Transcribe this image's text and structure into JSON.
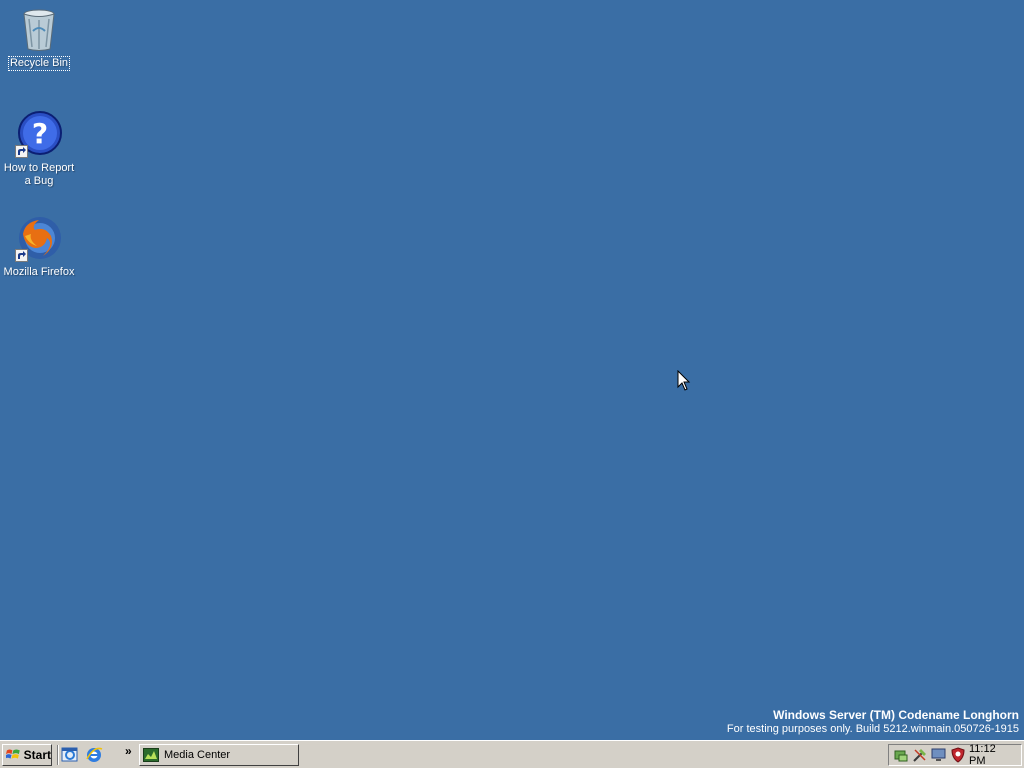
{
  "desktop": {
    "background_color": "#3a6ea5",
    "icons": [
      {
        "label": "Recycle Bin",
        "icon": "recycle-bin-icon"
      },
      {
        "label": "How to Report a Bug",
        "icon": "help-icon"
      },
      {
        "label": "Mozilla Firefox",
        "icon": "firefox-icon"
      }
    ]
  },
  "watermark": {
    "title": "Windows Server (TM) Codename Longhorn",
    "subtitle": "For testing purposes only. Build 5212.winmain.050726-1915"
  },
  "taskbar": {
    "start_label": "Start",
    "quicklaunch_icons": [
      "show-desktop-icon",
      "internet-explorer-icon"
    ],
    "overflow_label": "»",
    "tasks": [
      {
        "label": "Media Center",
        "icon": "media-center-icon"
      }
    ],
    "tray_icons": [
      "network-icon",
      "tools-icon",
      "monitor-icon",
      "security-shield-icon"
    ],
    "clock": "11:12 PM"
  }
}
